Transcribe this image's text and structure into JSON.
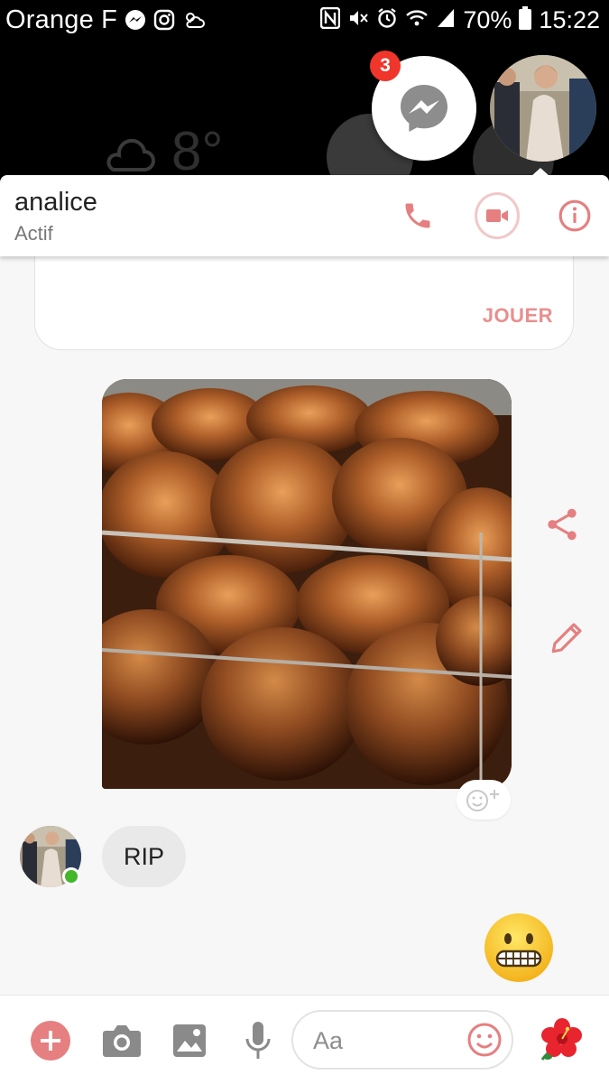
{
  "status_bar": {
    "carrier": "Orange F",
    "battery": "70%",
    "time": "15:22",
    "icons": [
      "messenger-icon",
      "instagram-icon",
      "weather-icon",
      "nfc-icon",
      "mute-icon",
      "alarm-icon",
      "wifi-icon",
      "signal-icon",
      "battery-icon"
    ]
  },
  "chat_heads": {
    "badge_count": "3",
    "icons": [
      "messenger-icon",
      "contact-avatar"
    ]
  },
  "header": {
    "name": "analice",
    "status": "Actif",
    "icons": [
      "phone-icon",
      "video-icon",
      "info-icon"
    ],
    "accent": "#e57f80"
  },
  "game_card": {
    "button_label": "JOUER"
  },
  "messages": {
    "image_icons": [
      "share-icon",
      "edit-icon",
      "add-reaction-icon"
    ],
    "received_text": "RIP",
    "sent_emoji": "grimacing-emoji",
    "online_color": "#42b72a"
  },
  "composer": {
    "placeholder": "Aa",
    "icons": [
      "plus-icon",
      "camera-icon",
      "image-icon",
      "microphone-icon",
      "emoji-icon",
      "flower-icon"
    ]
  }
}
